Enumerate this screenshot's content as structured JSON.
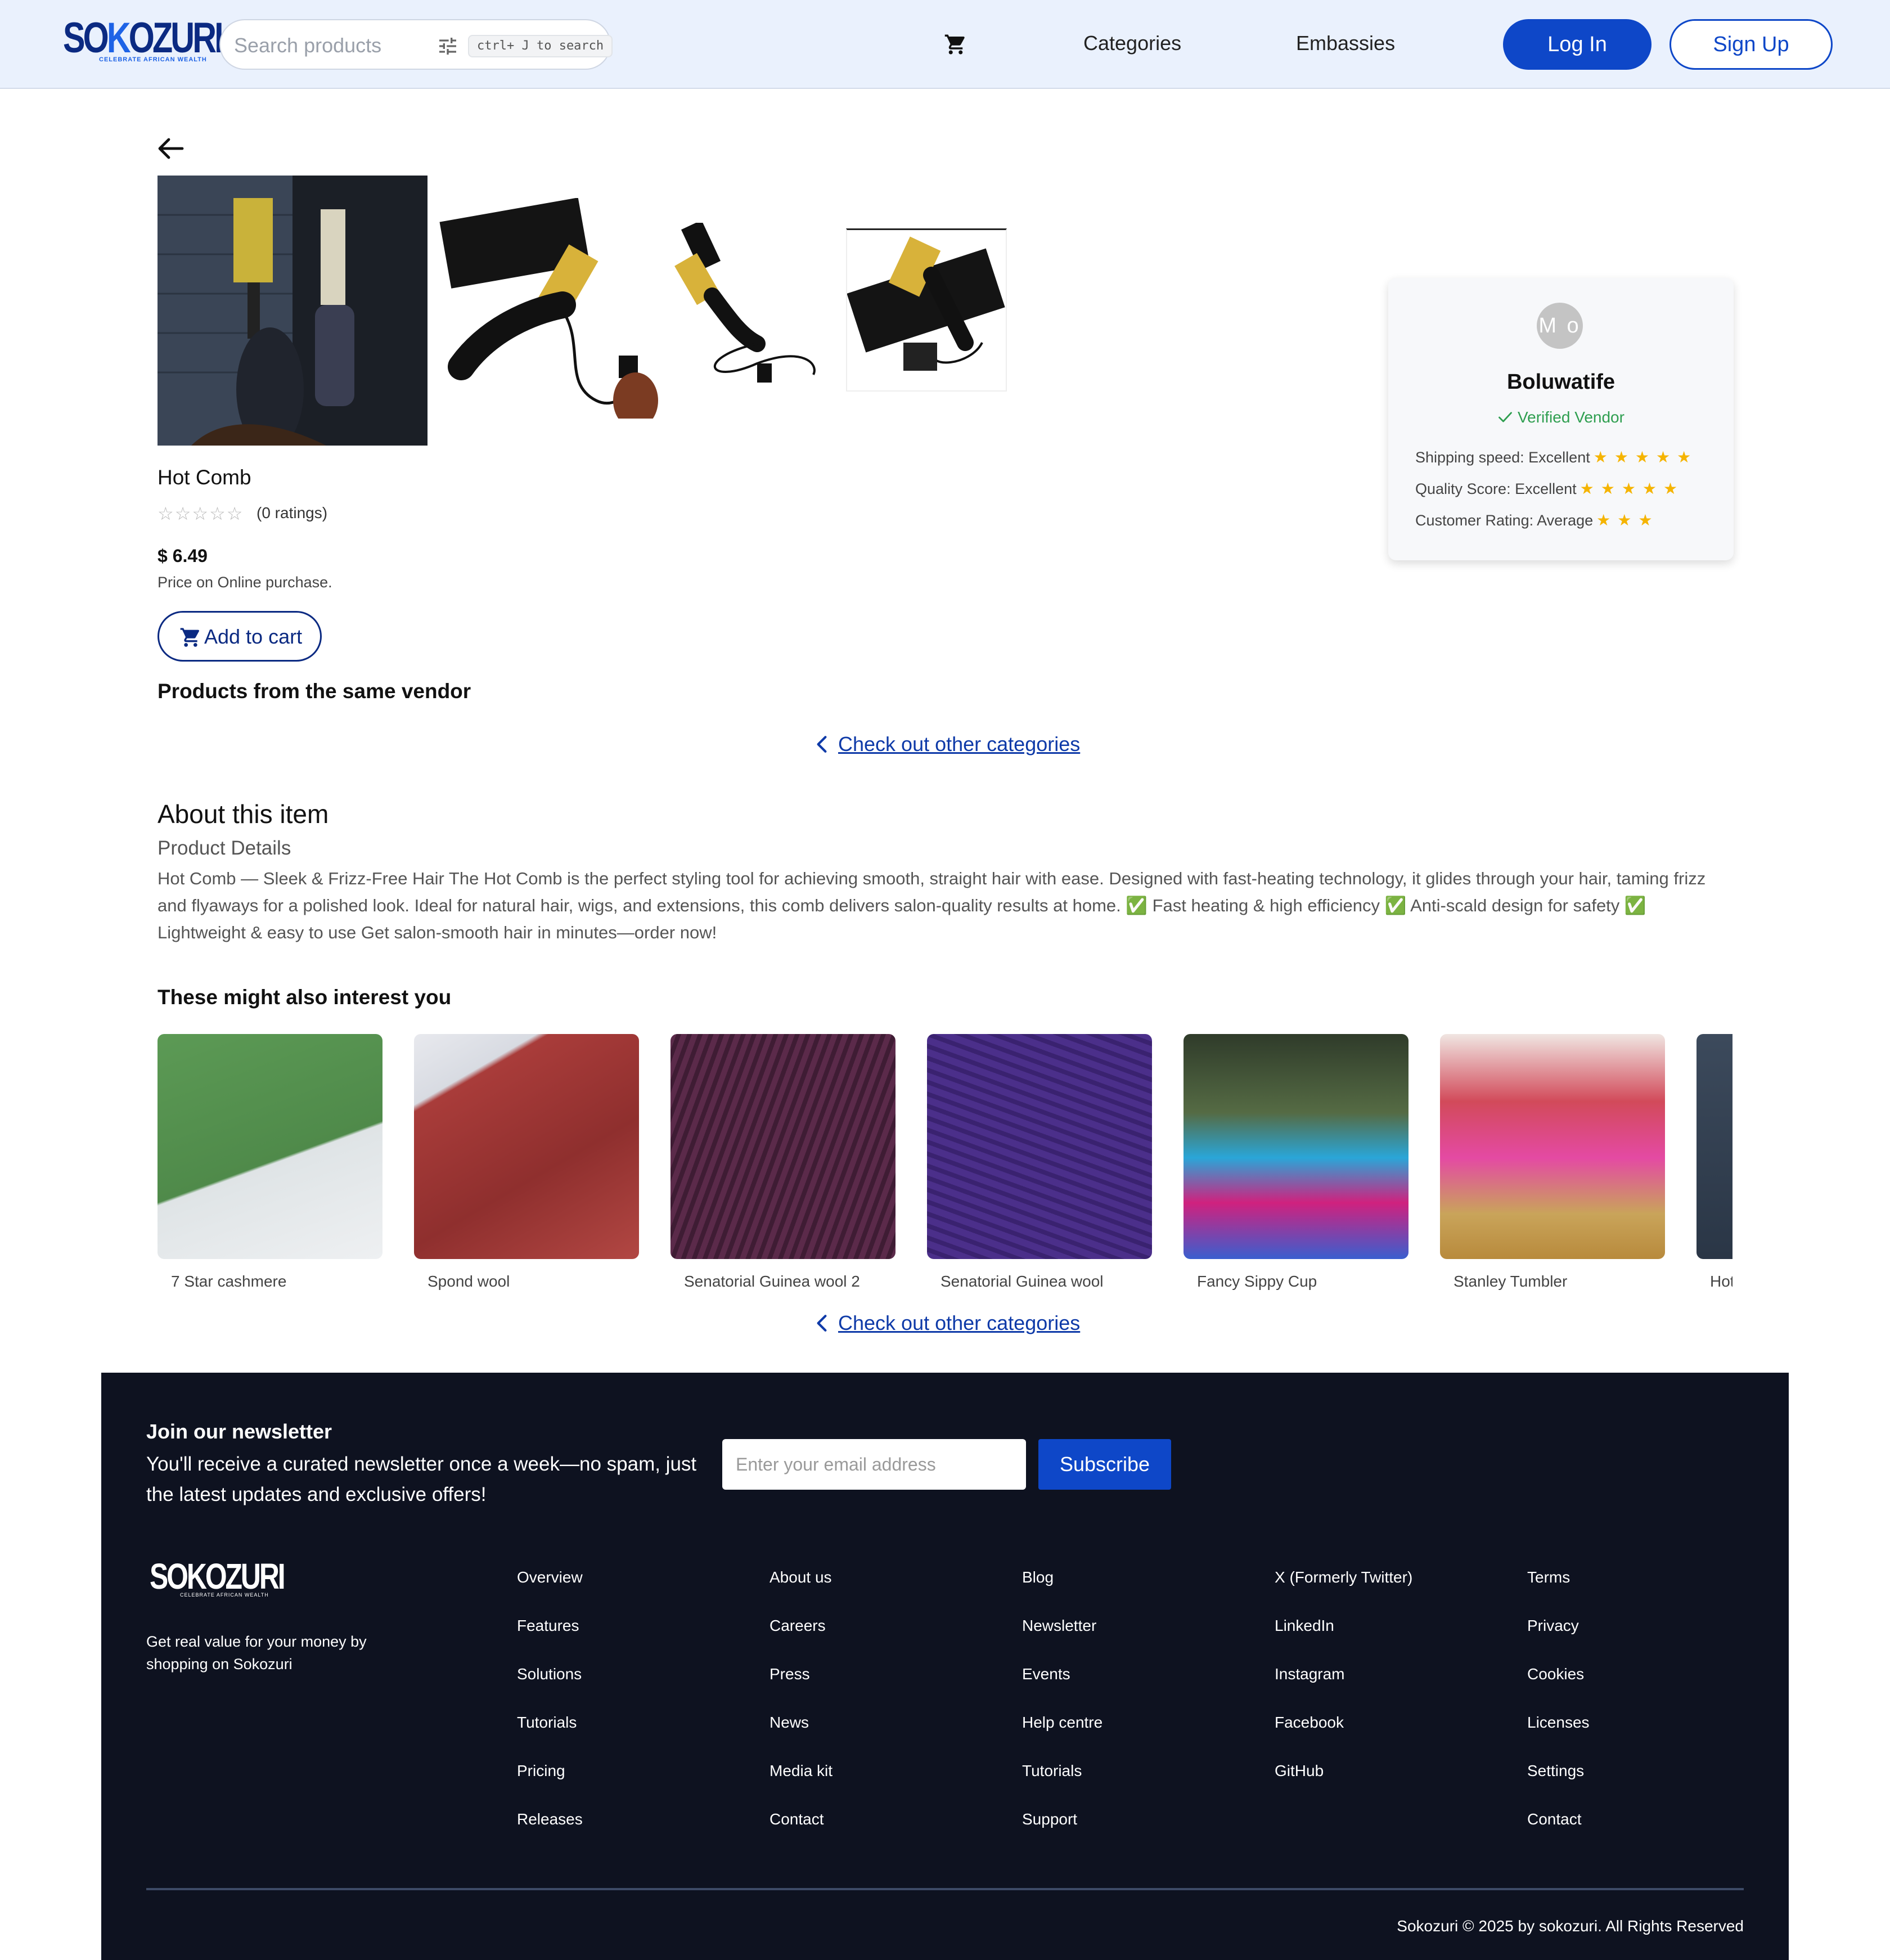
{
  "header": {
    "logo_text": "SOKOZURI",
    "logo_tagline": "CELEBRATE AFRICAN WEALTH",
    "search_placeholder": "Search products",
    "search_shortcut": "ctrl+ J to search",
    "nav": [
      "Categories",
      "Embassies"
    ],
    "login_label": "Log In",
    "signup_label": "Sign Up"
  },
  "product": {
    "title": "Hot Comb",
    "rating_stars": 0,
    "ratings_count": "(0 ratings)",
    "price": "$ 6.49",
    "price_note": "Price on Online purchase.",
    "add_to_cart_label": "Add to cart",
    "gallery_count": 4
  },
  "vendor": {
    "avatar_initials": "M o",
    "name": "Boluwatife",
    "verified_label": "Verified Vendor",
    "scores": [
      {
        "label": "Shipping speed: Excellent",
        "stars": 5
      },
      {
        "label": "Quality Score: Excellent",
        "stars": 5
      },
      {
        "label": "Customer Rating: Average",
        "stars": 3
      }
    ]
  },
  "same_vendor_title": "Products from the same vendor",
  "other_categories_link": "Check out other categories",
  "about": {
    "heading": "About this item",
    "subheading": "Product Details",
    "body": "Hot Comb — Sleek & Frizz-Free Hair The Hot Comb is the perfect styling tool for achieving smooth, straight hair with ease. Designed with fast-heating technology, it glides through your hair, taming frizz and flyaways for a polished look. Ideal for natural hair, wigs, and extensions, this comb delivers salon-quality results at home. ✅ Fast heating & high efficiency ✅ Anti-scald design for safety ✅ Lightweight & easy to use Get salon-smooth hair in minutes—order now!"
  },
  "recommended": {
    "title": "These might also interest you",
    "items": [
      {
        "name": "7 Star cashmere"
      },
      {
        "name": "Spond wool"
      },
      {
        "name": "Senatorial Guinea wool 2"
      },
      {
        "name": "Senatorial Guinea wool"
      },
      {
        "name": "Fancy Sippy Cup"
      },
      {
        "name": "Stanley Tumbler"
      },
      {
        "name": "Hot Comb"
      }
    ]
  },
  "footer": {
    "newsletter_title": "Join our newsletter",
    "newsletter_text": "You'll receive a curated newsletter once a week—no spam, just the latest updates and exclusive offers!",
    "email_placeholder": "Enter your email address",
    "subscribe_label": "Subscribe",
    "logo_text": "SOKOZURI",
    "logo_tagline": "CELEBRATE AFRICAN WEALTH",
    "tagline": "Get real value for your money by shopping on Sokozuri",
    "columns": [
      [
        "Overview",
        "Features",
        "Solutions",
        "Tutorials",
        "Pricing",
        "Releases"
      ],
      [
        "About us",
        "Careers",
        "Press",
        "News",
        "Media kit",
        "Contact"
      ],
      [
        "Blog",
        "Newsletter",
        "Events",
        "Help centre",
        "Tutorials",
        "Support"
      ],
      [
        "X (Formerly Twitter)",
        "LinkedIn",
        "Instagram",
        "Facebook",
        "GitHub"
      ],
      [
        "Terms",
        "Privacy",
        "Cookies",
        "Licenses",
        "Settings",
        "Contact"
      ]
    ],
    "copyright": "Sokozuri © 2025 by sokozuri. All Rights Reserved"
  },
  "colors": {
    "brand_blue": "#0e47c8",
    "brand_navy": "#0b2a82",
    "header_bg": "#eaf1fd",
    "footer_bg": "#0e1220",
    "verified_green": "#2e9e4f",
    "star_gold": "#f5b400"
  },
  "icons": {
    "back": "arrow-left-icon",
    "cart": "cart-icon",
    "filter": "tune-icon",
    "verified": "check-icon",
    "link": "chevron-left-icon"
  }
}
